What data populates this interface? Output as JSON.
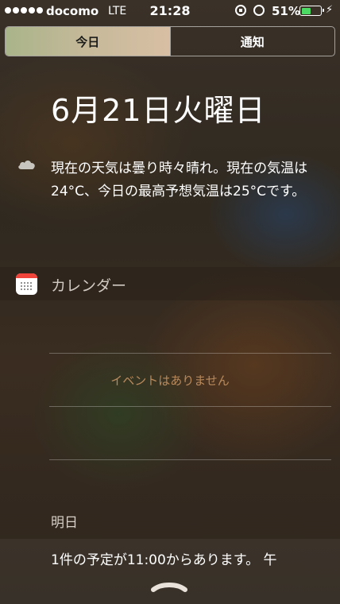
{
  "status_bar": {
    "carrier": "docomo",
    "network": "LTE",
    "time": "21:28",
    "battery_percent": "51%",
    "battery_level": 0.51,
    "battery_color": "#4cd964"
  },
  "tabs": [
    {
      "label": "今日",
      "active": true
    },
    {
      "label": "通知",
      "active": false
    }
  ],
  "today": {
    "date": "6月21日火曜日",
    "weather_icon": "cloud-icon",
    "weather_summary": "現在の天気は曇り時々晴れ。現在の気温は24°C、今日の最高予想気温は25°Cです。"
  },
  "calendar": {
    "title": "カレンダー",
    "icon": "calendar-icon",
    "empty_message": "イベントはありません",
    "empty_message_color": "#b98a5c"
  },
  "tomorrow": {
    "label": "明日",
    "summary": "1件の予定が11:00からあります。 午"
  }
}
